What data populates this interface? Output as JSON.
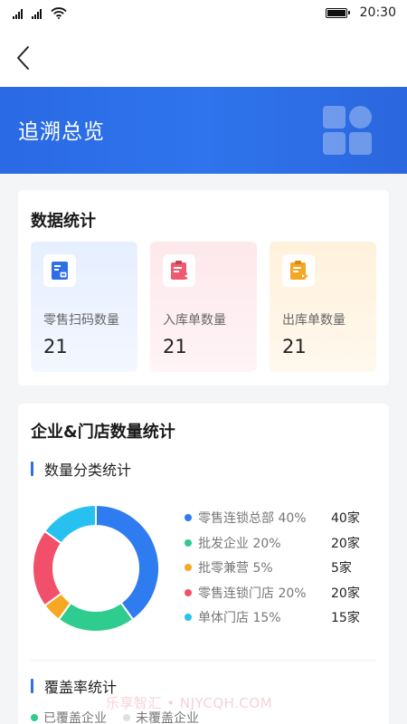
{
  "status_bar": {
    "time": "20:30"
  },
  "banner": {
    "title": "追溯总览"
  },
  "data_stats": {
    "title": "数据统计",
    "items": [
      {
        "label": "零售扫码数量",
        "value": "21",
        "icon": "scan-code-icon",
        "color": "#2f6fe6"
      },
      {
        "label": "入库单数量",
        "value": "21",
        "icon": "inbound-doc-icon",
        "color": "#ef5a6f"
      },
      {
        "label": "出库单数量",
        "value": "21",
        "icon": "outbound-doc-icon",
        "color": "#f5a623"
      }
    ]
  },
  "enterprise_stats": {
    "title": "企业&门店数量统计",
    "category_section": "数量分类统计",
    "coverage_section": "覆盖率统计",
    "coverage_legend": [
      {
        "label": "已覆盖企业",
        "color": "#2ecc8f"
      },
      {
        "label": "未覆盖企业",
        "color": "#e0e0e0"
      }
    ]
  },
  "chart_data": {
    "type": "pie",
    "donut": true,
    "series": [
      {
        "label": "零售连锁总部 40%",
        "count": "40家",
        "value": 40,
        "color": "#2f7bf0"
      },
      {
        "label": "批发企业 20%",
        "count": "20家",
        "value": 20,
        "color": "#2ecc8f"
      },
      {
        "label": "批零兼营 5%",
        "count": "5家",
        "value": 5,
        "color": "#f7a823"
      },
      {
        "label": "零售连锁门店 20%",
        "count": "20家",
        "value": 20,
        "color": "#f2506a"
      },
      {
        "label": "单体门店 15%",
        "count": "15家",
        "value": 15,
        "color": "#27c1f0"
      }
    ]
  },
  "watermark": "乐享智汇 • NJYCQH.COM"
}
